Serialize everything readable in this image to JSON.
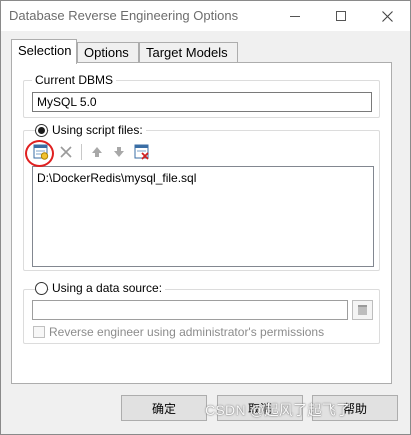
{
  "window": {
    "title": "Database Reverse Engineering Options"
  },
  "tabs": [
    {
      "label": "Selection"
    },
    {
      "label": "Options"
    },
    {
      "label": "Target Models"
    }
  ],
  "current_dbms": {
    "group_label": "Current DBMS",
    "value": "MySQL 5.0"
  },
  "script_files": {
    "radio_label": "Using script files:",
    "toolbar": {
      "add": "add-file-icon",
      "delete": "delete-icon",
      "move_up": "arrow-up-icon",
      "move_down": "arrow-down-icon",
      "clear": "clear-list-icon"
    },
    "files": [
      "D:\\DockerRedis\\mysql_file.sql"
    ]
  },
  "data_source": {
    "radio_label": "Using a data source:",
    "value": "",
    "admin_checkbox_label": "Reverse engineer using administrator's permissions"
  },
  "buttons": {
    "ok": "确定",
    "cancel": "取消",
    "help": "帮助"
  },
  "watermark": "CSDN @起风了起飞了"
}
